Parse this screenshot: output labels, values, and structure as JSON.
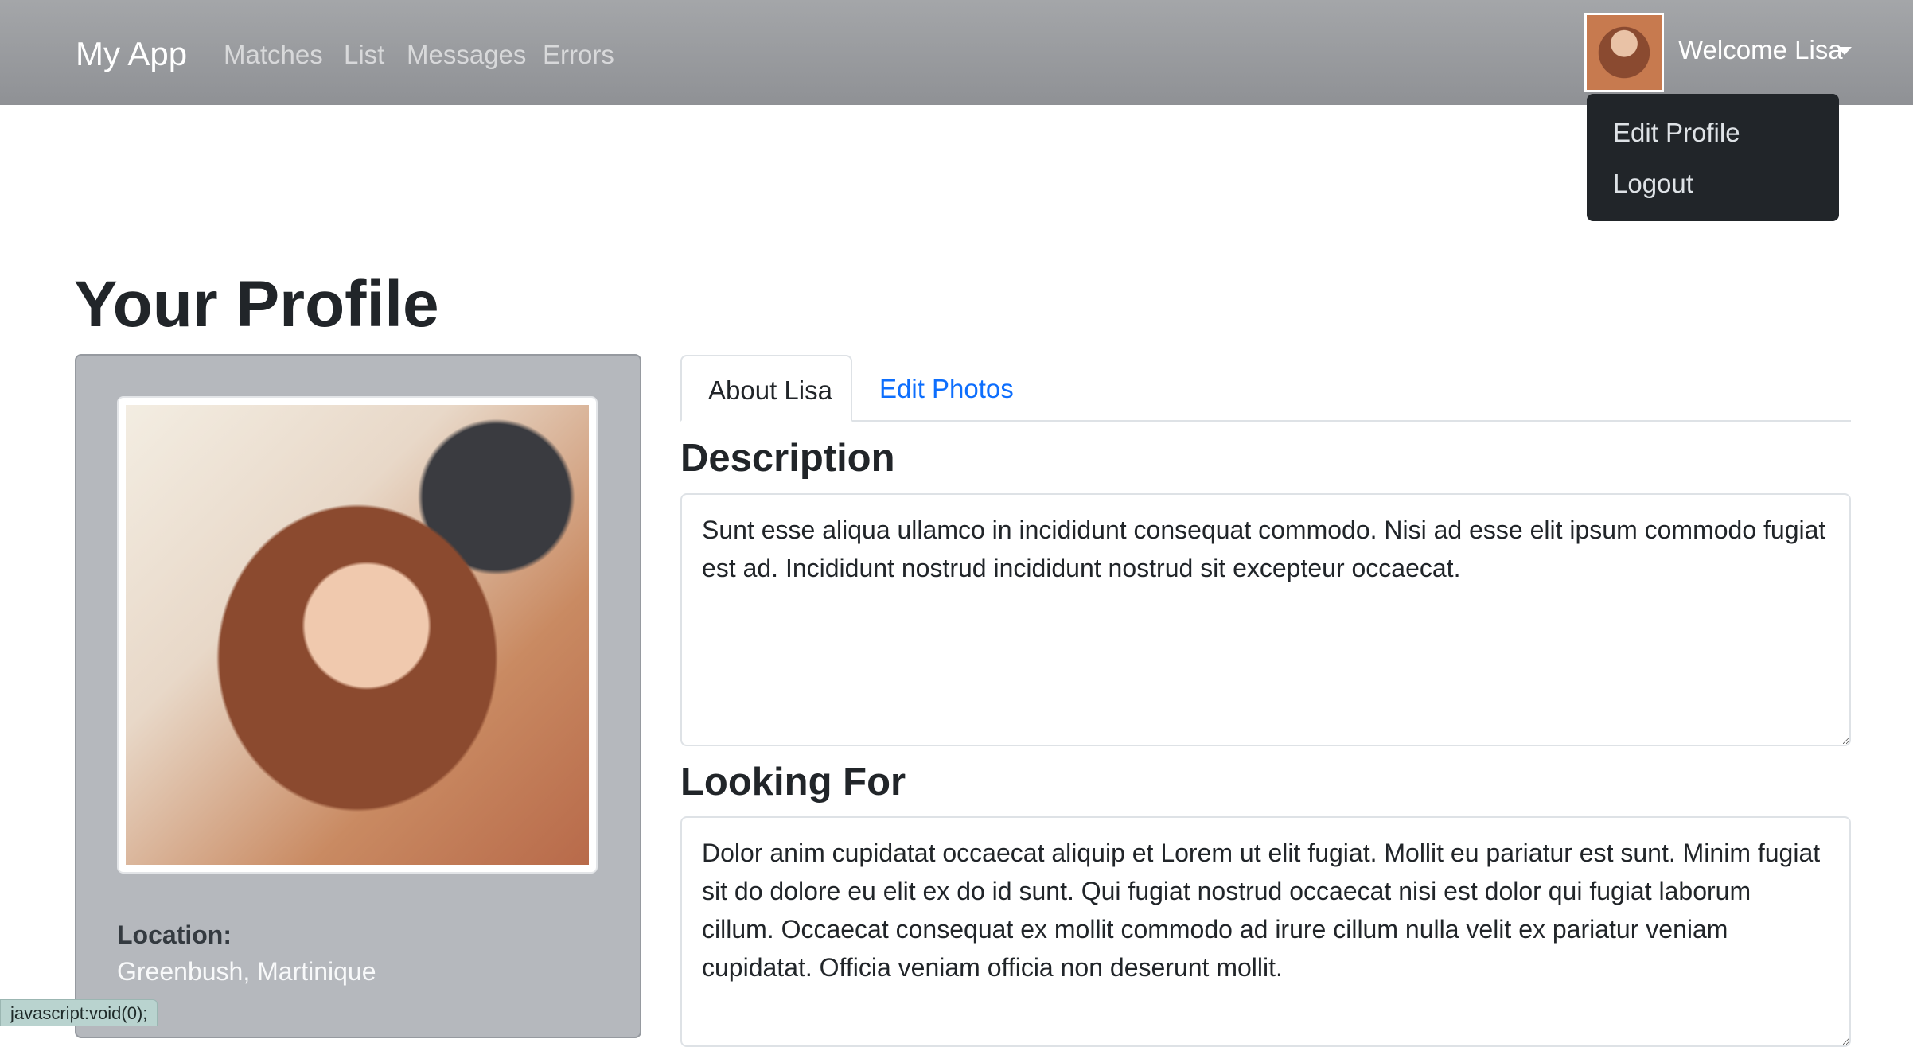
{
  "navbar": {
    "brand": "My App",
    "links": [
      "Matches",
      "List",
      "Messages",
      "Errors"
    ],
    "welcome": "Welcome Lisa",
    "dropdown": [
      "Edit Profile",
      "Logout"
    ]
  },
  "page": {
    "title": "Your Profile"
  },
  "card": {
    "location_label": "Location:",
    "location_value": "Greenbush, Martinique"
  },
  "tabs": [
    "About Lisa",
    "Edit Photos"
  ],
  "sections": {
    "description_heading": "Description",
    "description_text": "Sunt esse aliqua ullamco in incididunt consequat commodo. Nisi ad esse elit ipsum commodo fugiat est ad. Incididunt nostrud incididunt nostrud sit excepteur occaecat.",
    "looking_for_heading": "Looking For",
    "looking_for_text": "Dolor anim cupidatat occaecat aliquip et Lorem ut elit fugiat. Mollit eu pariatur est sunt. Minim fugiat sit do dolore eu elit ex do id sunt. Qui fugiat nostrud occaecat nisi est dolor qui fugiat laborum cillum. Occaecat consequat ex mollit commodo ad irure cillum nulla velit ex pariatur veniam cupidatat. Officia veniam officia non deserunt mollit."
  },
  "status_bar": "javascript:void(0);",
  "colors": {
    "link": "#0d6efd",
    "dropdown_bg": "#212529",
    "card_bg": "#b5b8bd"
  }
}
